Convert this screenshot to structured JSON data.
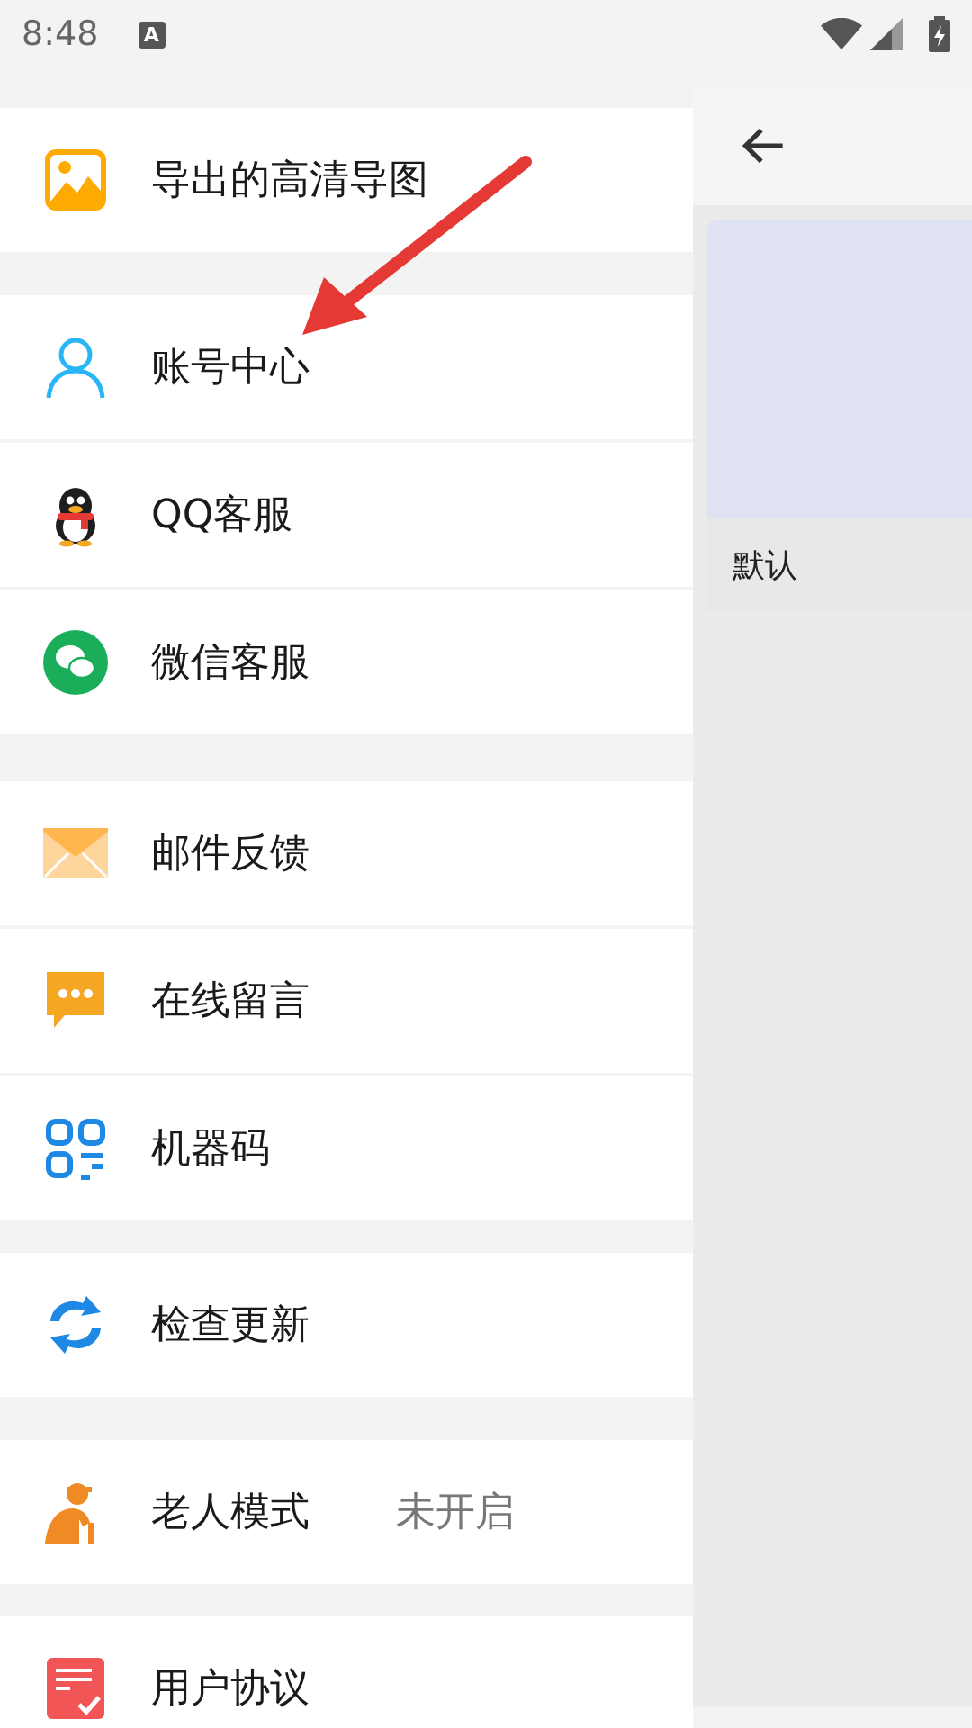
{
  "status_bar": {
    "time": "8:48",
    "notification_glyph": "A"
  },
  "menu_sections": [
    {
      "items": [
        {
          "label": "导出的高清导图"
        }
      ]
    },
    {
      "items": [
        {
          "label": "账号中心"
        },
        {
          "label": "QQ客服"
        },
        {
          "label": "微信客服"
        }
      ]
    },
    {
      "items": [
        {
          "label": "邮件反馈"
        },
        {
          "label": "在线留言"
        },
        {
          "label": "机器码"
        }
      ]
    },
    {
      "items": [
        {
          "label": "检查更新"
        }
      ]
    },
    {
      "items": [
        {
          "label": "老人模式",
          "value": "未开启"
        }
      ]
    },
    {
      "items": [
        {
          "label": "用户协议"
        }
      ]
    }
  ],
  "background_page": {
    "cards": [
      {
        "title": "默认"
      }
    ]
  }
}
